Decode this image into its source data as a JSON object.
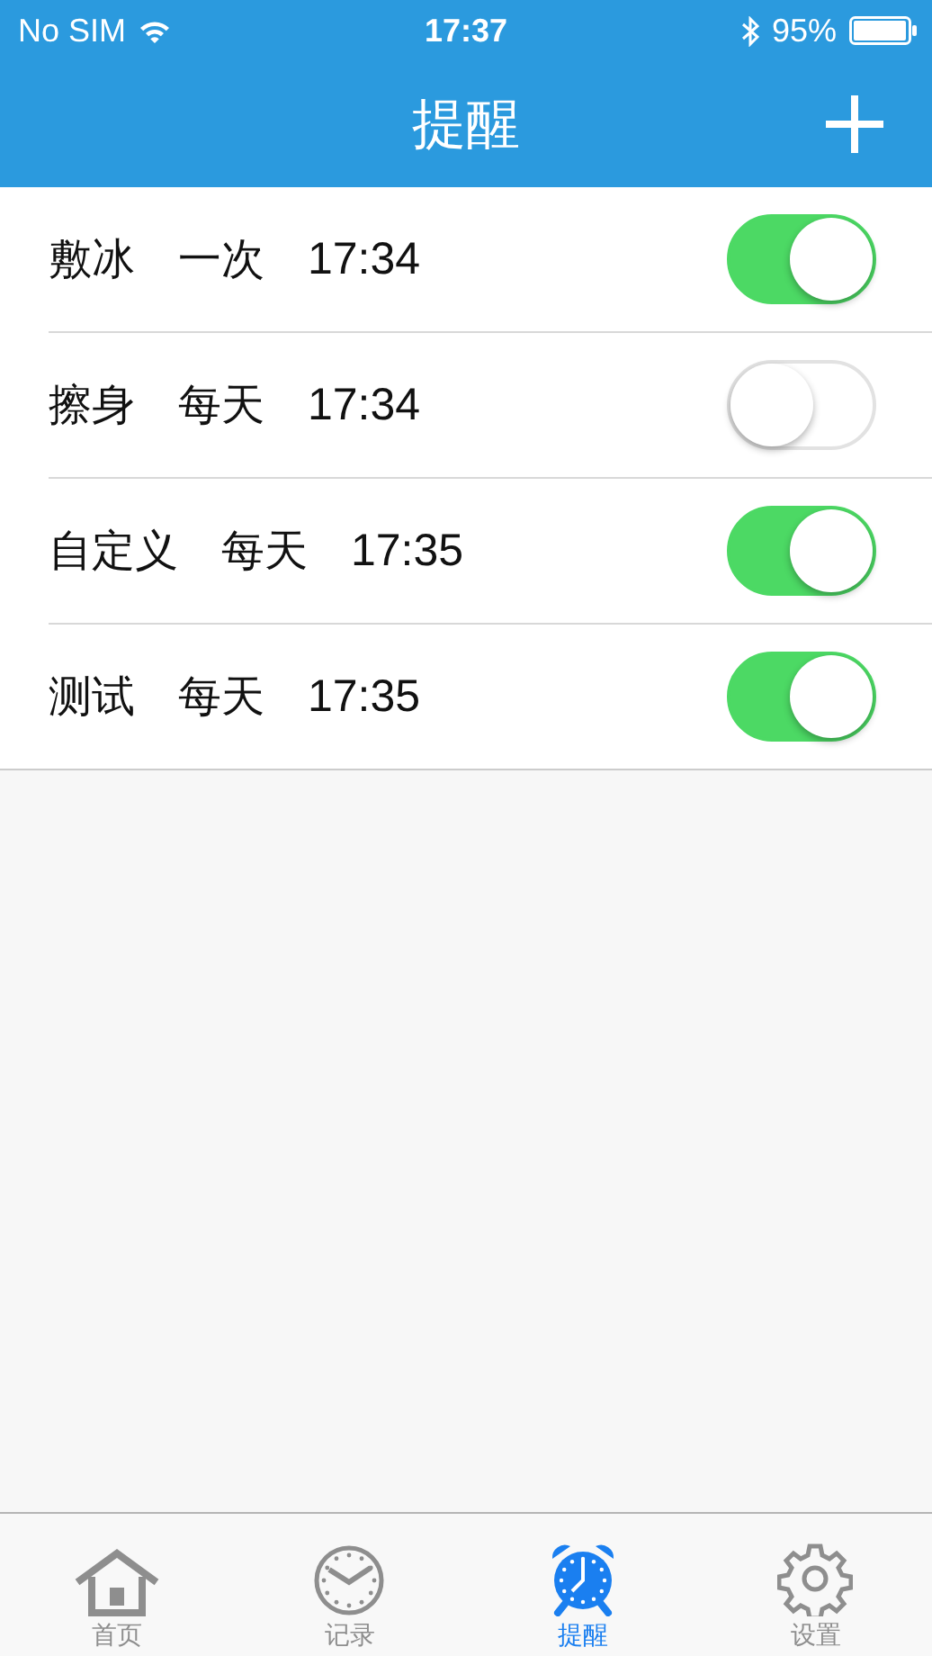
{
  "status_bar": {
    "carrier": "No SIM",
    "time": "17:37",
    "battery": "95%"
  },
  "nav": {
    "title": "提醒"
  },
  "reminders": [
    {
      "name": "敷冰",
      "repeat": "一次",
      "time": "17:34",
      "on": true
    },
    {
      "name": "擦身",
      "repeat": "每天",
      "time": "17:34",
      "on": false
    },
    {
      "name": "自定义",
      "repeat": "每天",
      "time": "17:35",
      "on": true
    },
    {
      "name": "测试",
      "repeat": "每天",
      "time": "17:35",
      "on": true
    }
  ],
  "tabs": [
    {
      "label": "首页",
      "kind": "home",
      "selected": false
    },
    {
      "label": "记录",
      "kind": "clock",
      "selected": false
    },
    {
      "label": "提醒",
      "kind": "alarm",
      "selected": true
    },
    {
      "label": "设置",
      "kind": "gear",
      "selected": false
    }
  ]
}
